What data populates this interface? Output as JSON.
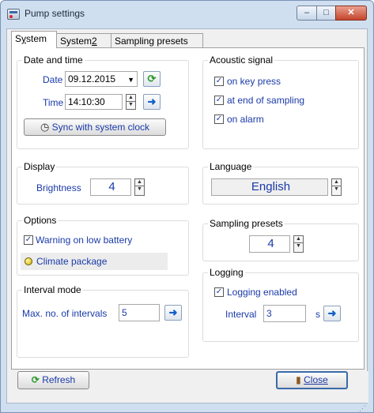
{
  "window": {
    "title": "Pump settings",
    "caption_buttons": {
      "minimize": "–",
      "maximize": "□",
      "close": "✕"
    }
  },
  "tabs": [
    {
      "label_pre": "S",
      "label_underline": "y",
      "label_post": "stem"
    },
    {
      "label_pre": "System",
      "label_underline": "2",
      "label_post": ""
    },
    {
      "label_pre": "Sampling presets",
      "label_underline": "",
      "label_post": ""
    }
  ],
  "date_time": {
    "title": "Date and time",
    "date_label": "Date",
    "date_value": "09.12.2015",
    "time_label": "Time",
    "time_value": "14:10:30",
    "sync_label": "Sync with system clock"
  },
  "acoustic": {
    "title": "Acoustic signal",
    "items": [
      {
        "label": "on key press",
        "checked": true
      },
      {
        "label": "at end of sampling",
        "checked": true
      },
      {
        "label": "on alarm",
        "checked": true
      }
    ]
  },
  "display": {
    "title": "Display",
    "brightness_label": "Brightness",
    "brightness_value": "4"
  },
  "language": {
    "title": "Language",
    "value": "English"
  },
  "options": {
    "title": "Options",
    "low_battery_label": "Warning on low battery",
    "low_battery_checked": true,
    "climate_label": "Climate package"
  },
  "sampling_presets": {
    "title": "Sampling presets",
    "value": "4"
  },
  "interval_mode": {
    "title": "Interval mode",
    "max_label": "Max. no. of intervals",
    "max_value": "5"
  },
  "logging": {
    "title": "Logging",
    "enabled_label": "Logging enabled",
    "enabled_checked": true,
    "interval_label": "Interval",
    "interval_value": "3",
    "unit": "s"
  },
  "footer": {
    "refresh_label": "Refresh",
    "close_label": "Close"
  },
  "icons": {
    "check": "✓",
    "arrow_right": "➜",
    "refresh": "⟳",
    "clock": "◷",
    "up": "▲",
    "down": "▼",
    "dropdown": "▼",
    "door": "▮"
  },
  "colors": {
    "label_blue": "#1a3aa8",
    "titlebar": "#cfdff0"
  }
}
